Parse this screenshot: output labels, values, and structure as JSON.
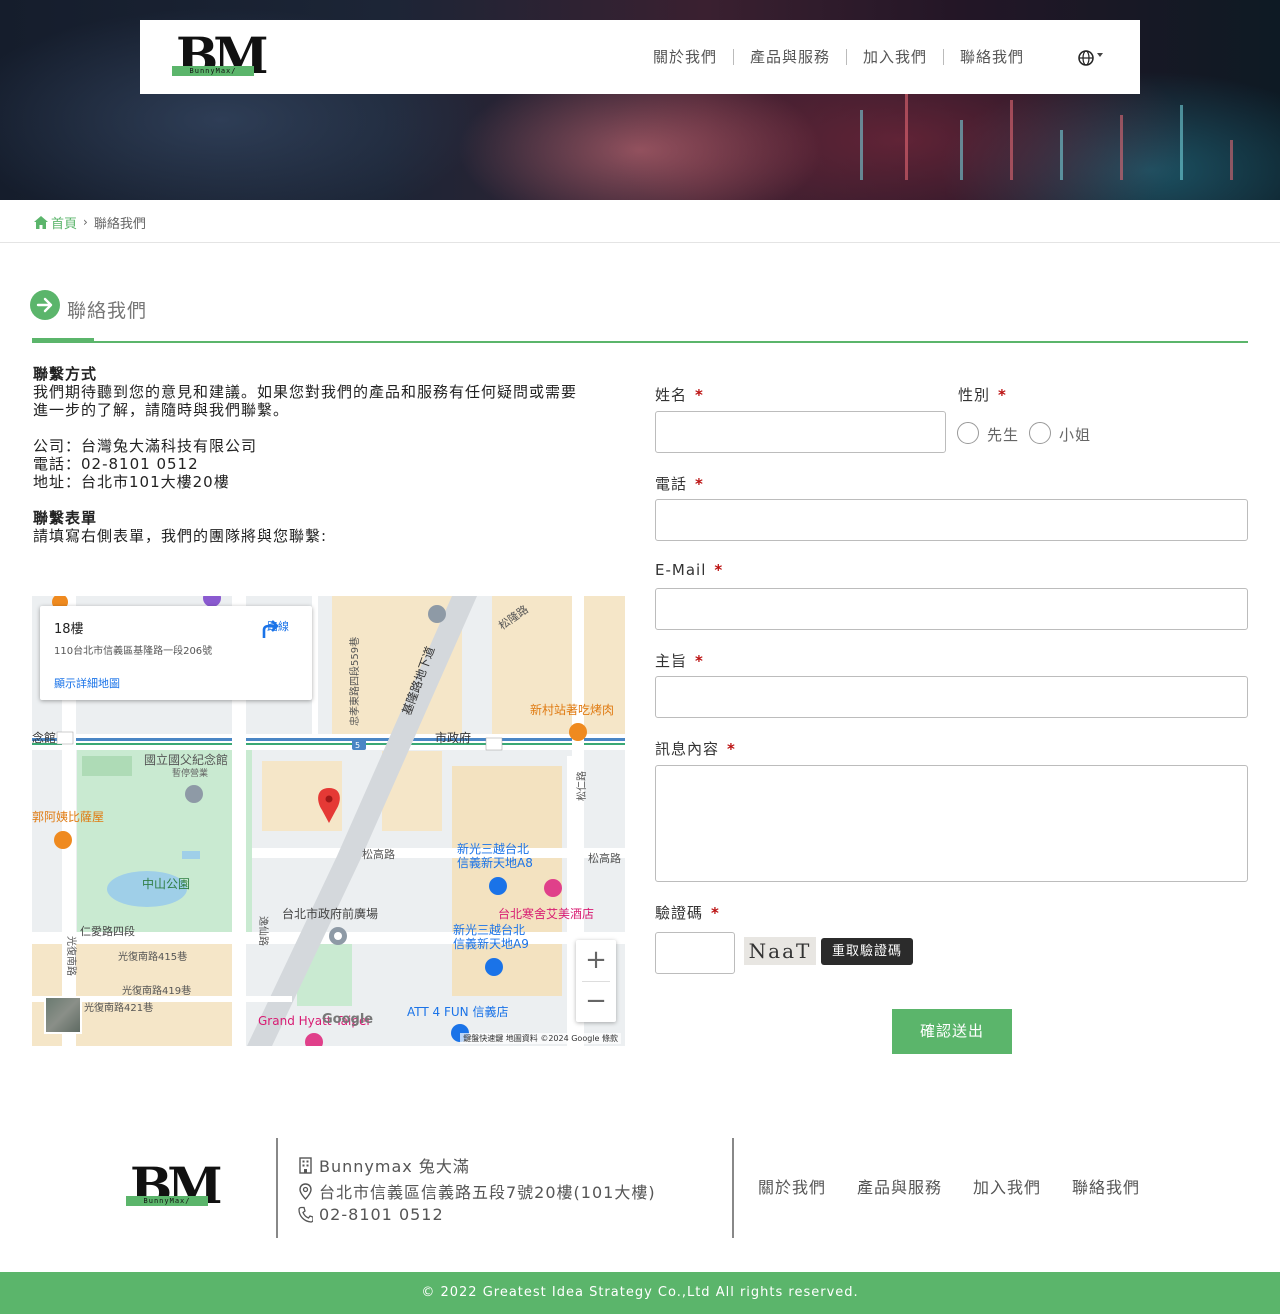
{
  "brand": {
    "logo_text": "BM",
    "logo_band": "BunnyMax/"
  },
  "nav": {
    "items": [
      "關於我們",
      "產品與服務",
      "加入我們",
      "聯絡我們"
    ]
  },
  "breadcrumb": {
    "home": "首頁",
    "current": "聯絡我們"
  },
  "section_title": "聯絡我們",
  "info": {
    "contact_heading": "聯繫方式",
    "contact_text_1": "我們期待聽到您的意見和建議。如果您對我們的產品和服務有任何疑問或需要",
    "contact_text_2": "進一步的了解，請隨時與我們聯繫。",
    "company": "公司：台灣兔大滿科技有限公司",
    "phone": "電話：02-8101 0512",
    "address": "地址：台北市101大樓20樓",
    "form_heading": "聯繫表單",
    "form_text": "請填寫右側表單，我們的團隊將與您聯繫:"
  },
  "map": {
    "card_title": "18樓",
    "card_address": "110台北市信義區基隆路一段206號",
    "card_link": "顯示詳細地圖",
    "directions": "路線",
    "zoom_in": "+",
    "zoom_out": "−",
    "google": "Google",
    "attribution": "鍵盤快速鍵  地圖資料 ©2024 Google  條款",
    "labels": {
      "guofu": "國立國父紀念館",
      "guofu_sub": "暫停營業",
      "zhongshan_park": "中山公園",
      "songgao_rd": "松高路",
      "songgao_rd_2": "松高路",
      "cityhall_square": "台北市政府前廣場",
      "renai_rd": "仁愛路四段",
      "guangfu_415": "光復南路415巷",
      "guangfu_419": "光復南路419巷",
      "guangfu_421": "光復南路421巷",
      "shin_kong_a8_1": "新光三越台北",
      "shin_kong_a8_2": "信義新天地A8",
      "shin_kong_a9_1": "新光三越台北",
      "shin_kong_a9_2": "信義新天地A9",
      "w_hotel": "台北寒舍艾美酒店",
      "att4fun": "ATT 4 FUN 信義店",
      "grand_hyatt": "Grand Hyatt Taipei",
      "bbq": "新村站著吃烤肉",
      "pizza": "郭阿姨比薩屋",
      "keelung_rd": "基隆路地下道",
      "songlong_rd": "松隆路",
      "cityhall_station": "市政府",
      "songren_rd": "松仁路",
      "zhongxiao_rd": "忠孝東路四段559巷",
      "guangfu_s": "光復南路",
      "yixian_rd": "逸仙路",
      "station_left": "念館",
      "route_num": "5"
    }
  },
  "form": {
    "name_label": "姓名",
    "gender_label": "性別",
    "gender_options": [
      "先生",
      "小姐"
    ],
    "phone_label": "電話",
    "email_label": "E-Mail",
    "subject_label": "主旨",
    "message_label": "訊息內容",
    "captcha_label": "驗證碼",
    "captcha_text": "NaaT",
    "refresh_label": "重取驗證碼",
    "submit_label": "確認送出",
    "required_mark": "*"
  },
  "footer": {
    "company": "Bunnymax 兔大滿",
    "address": "台北市信義區信義路五段7號20樓(101大樓)",
    "phone": "02-8101 0512",
    "links": [
      "關於我們",
      "產品與服務",
      "加入我們",
      "聯絡我們"
    ],
    "copyright": "© 2022 Greatest Idea Strategy Co.,Ltd All rights reserved."
  },
  "colors": {
    "accent": "#5bb56b",
    "required": "#bb1111",
    "button_dark": "#2b2b2b"
  }
}
